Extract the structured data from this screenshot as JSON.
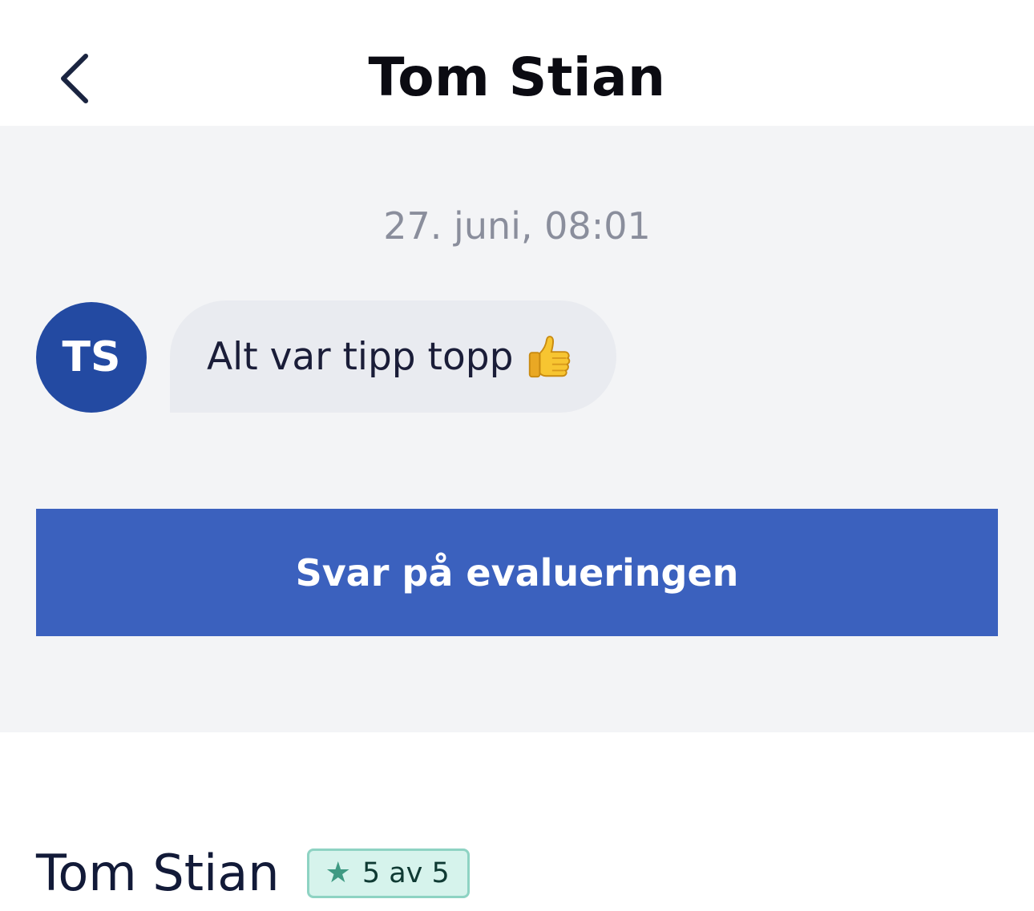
{
  "header": {
    "title": "Tom Stian",
    "back_icon": "chevron-left-icon"
  },
  "conversation": {
    "timestamp": "27. juni, 08:01",
    "message": {
      "avatar_initials": "TS",
      "avatar_color": "#234aa2",
      "text": "Alt var tipp topp",
      "emoji_icon": "thumbs-up-icon"
    }
  },
  "actions": {
    "reply_label": "Svar på evalueringen",
    "reply_color": "#3b61be"
  },
  "reviewer": {
    "name": "Tom Stian",
    "rating_label": "5 av 5",
    "rating_value": 5,
    "rating_max": 5,
    "rating_icon": "star-icon"
  }
}
